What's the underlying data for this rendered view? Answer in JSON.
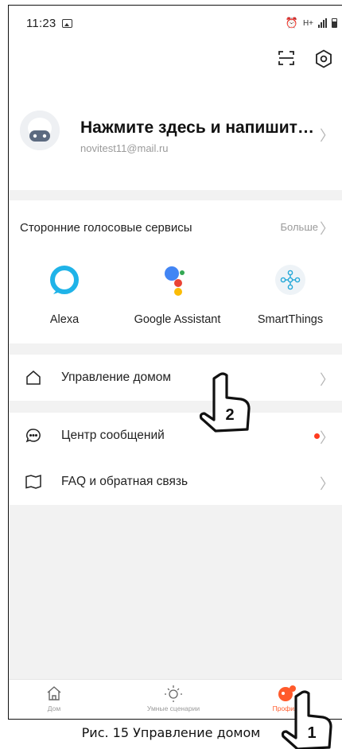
{
  "status_bar": {
    "time": "11:23",
    "network_label": "H+"
  },
  "profile": {
    "name": "Нажмите здесь и напишите с...",
    "email": "novitest11@mail.ru"
  },
  "voice_services": {
    "title": "Сторонние голосовые сервисы",
    "more_label": "Больше",
    "items": [
      {
        "label": "Alexa",
        "icon": "alexa-icon"
      },
      {
        "label": "Google Assistant",
        "icon": "google-assistant-icon"
      },
      {
        "label": "SmartThings",
        "icon": "smartthings-icon"
      }
    ]
  },
  "menu": {
    "home_management": "Управление домом",
    "message_center": "Центр сообщений",
    "faq": "FAQ и обратная связь"
  },
  "tabs": [
    {
      "label": "Дом",
      "icon": "home-icon"
    },
    {
      "label": "Умные сценарии",
      "icon": "sun-icon"
    },
    {
      "label": "Профиль",
      "icon": "profile-icon"
    }
  ],
  "annotations": {
    "pointer_1": "1",
    "pointer_2": "2"
  },
  "caption": "Рис. 15  Управление домом",
  "colors": {
    "accent": "#ff5a2b",
    "badge": "#ff3b1f",
    "alexa": "#1fb3e8"
  }
}
